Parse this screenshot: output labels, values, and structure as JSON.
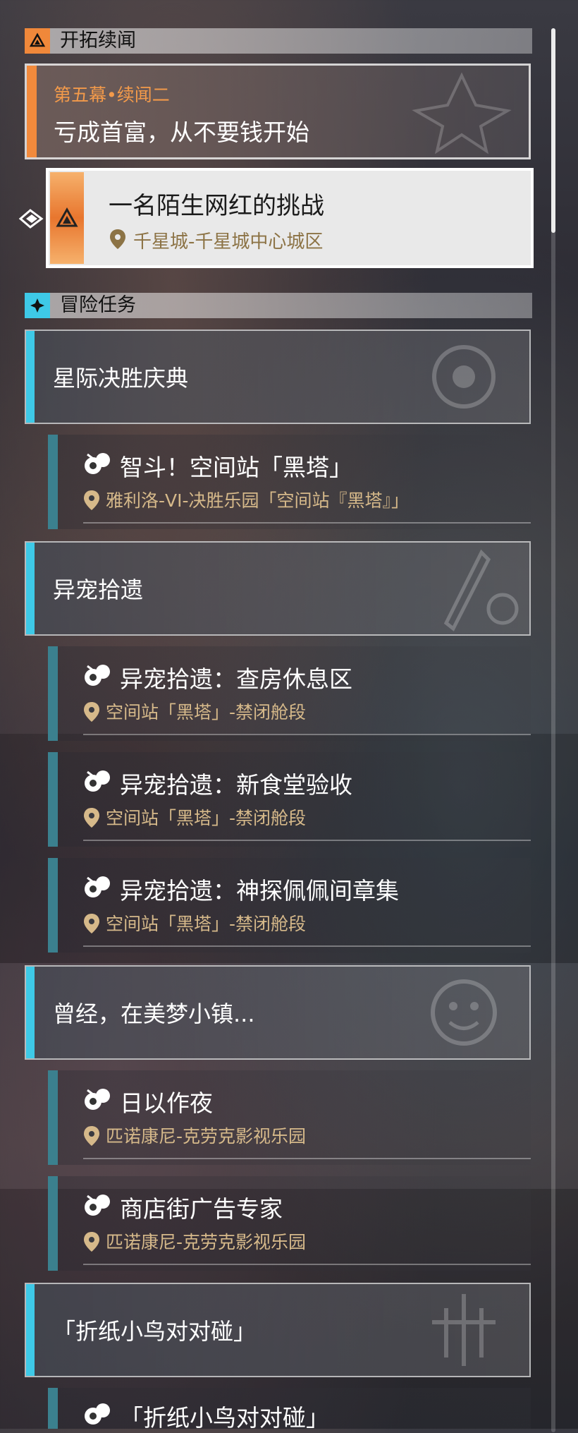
{
  "trailblaze": {
    "header": "开拓续闻",
    "chapter": "第五幕•续闻二",
    "title": "亏成首富，从不要钱开始",
    "active_quest": {
      "title": "一名陌生网红的挑战",
      "location": "千星城-千星城中心城区"
    }
  },
  "adventure": {
    "header": "冒险任务",
    "categories": [
      {
        "title": "星际决胜庆典",
        "quests": [
          {
            "title": "智斗！空间站「黑塔」",
            "location": "雅利洛-VI-决胜乐园「空间站『黑塔』」"
          }
        ]
      },
      {
        "title": "异宠拾遗",
        "quests": [
          {
            "title": "异宠拾遗：查房休息区",
            "location": "空间站「黑塔」-禁闭舱段"
          },
          {
            "title": "异宠拾遗：新食堂验收",
            "location": "空间站「黑塔」-禁闭舱段"
          },
          {
            "title": "异宠拾遗：神探佩佩间章集",
            "location": "空间站「黑塔」-禁闭舱段"
          }
        ]
      },
      {
        "title": "曾经，在美梦小镇...",
        "quests": [
          {
            "title": "日以作夜",
            "location": "匹诺康尼-克劳克影视乐园"
          },
          {
            "title": "商店街广告专家",
            "location": "匹诺康尼-克劳克影视乐园"
          }
        ]
      },
      {
        "title": "「折纸小鸟对对碰」",
        "quests": [
          {
            "title": "「折纸小鸟对对碰」",
            "location": ""
          }
        ]
      }
    ]
  },
  "colors": {
    "accent_orange": "#f28a3c",
    "accent_cyan": "#3ec9e7",
    "quest_bar": "#3b808e",
    "location_text": "#d6b98a"
  },
  "icons": [
    "trailblaze-icon",
    "adventure-icon",
    "tracking-arrow-icon",
    "quest-type-icon",
    "location-pin-icon",
    "scroll-bar"
  ]
}
